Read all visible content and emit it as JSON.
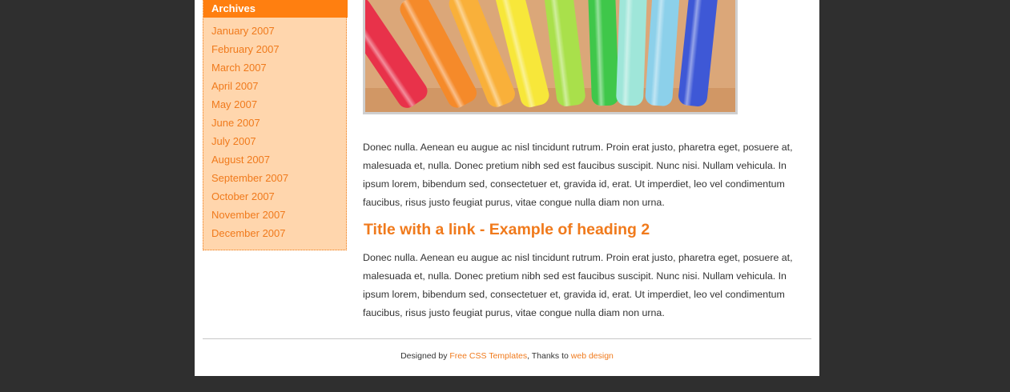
{
  "sidebar": {
    "heading": "Archives",
    "archives": [
      "January 2007",
      "February 2007",
      "March 2007",
      "April 2007",
      "May 2007",
      "June 2007",
      "July 2007",
      "August 2007",
      "September 2007",
      "October 2007",
      "November 2007",
      "December 2007"
    ]
  },
  "main": {
    "hero_image": "colored-markers-photo",
    "paragraph_1": "Donec nulla. Aenean eu augue ac nisl tincidunt rutrum. Proin erat justo, pharetra eget, posuere at, malesuada et, nulla. Donec pretium nibh sed est faucibus suscipit. Nunc nisi. Nullam vehicula. In ipsum lorem, bibendum sed, consectetuer et, gravida id, erat. Ut imperdiet, leo vel condimentum faucibus, risus justo feugiat purus, vitae congue nulla diam non urna.",
    "heading_2": "Title with a link - Example of heading 2",
    "paragraph_2": "Donec nulla. Aenean eu augue ac nisl tincidunt rutrum. Proin erat justo, pharetra eget, posuere at, malesuada et, nulla. Donec pretium nibh sed est faucibus suscipit. Nunc nisi. Nullam vehicula. In ipsum lorem, bibendum sed, consectetuer et, gravida id, erat. Ut imperdiet, leo vel condimentum faucibus, risus justo feugiat purus, vitae congue nulla diam non urna."
  },
  "footer": {
    "designed_by": "Designed by",
    "link_1": "Free CSS Templates",
    "thanks_to": ", Thanks to",
    "link_2": "web design"
  },
  "colors": {
    "background": "#2f2f2f",
    "accent": "#f07a1c",
    "sidebar_bg": "#ffd6ad",
    "sidebar_heading_bg": "#ff7f10"
  }
}
